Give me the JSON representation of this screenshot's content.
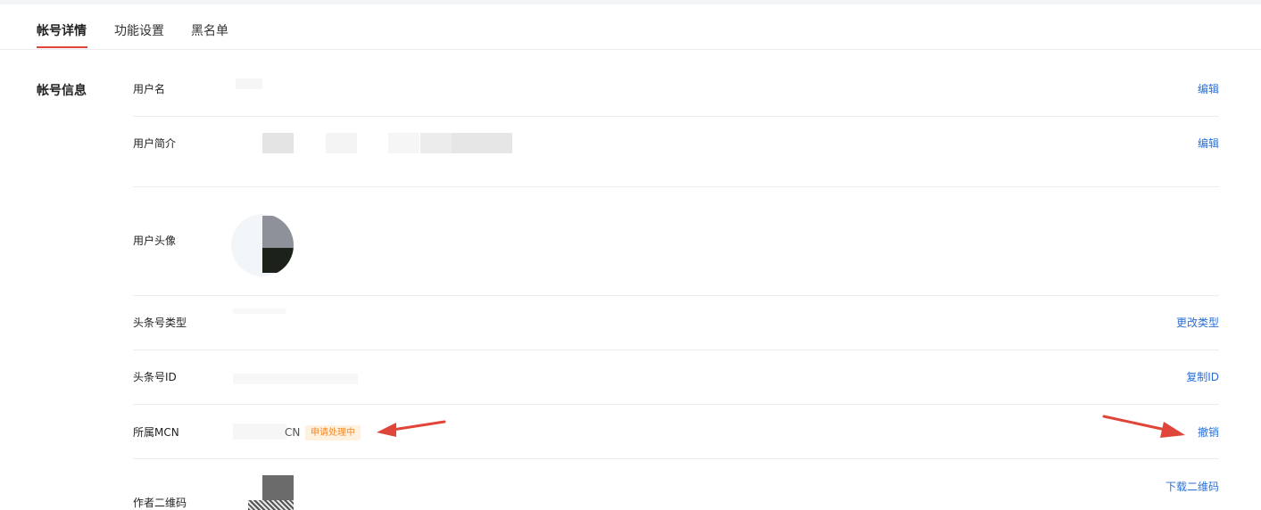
{
  "tabs": [
    {
      "label": "帐号详情",
      "active": true
    },
    {
      "label": "功能设置",
      "active": false
    },
    {
      "label": "黑名单",
      "active": false
    }
  ],
  "section": {
    "title": "帐号信息"
  },
  "rows": {
    "username": {
      "label": "用户名",
      "action": "编辑"
    },
    "bio": {
      "label": "用户简介",
      "action": "编辑"
    },
    "avatar": {
      "label": "用户头像"
    },
    "account_type": {
      "label": "头条号类型",
      "action": "更改类型"
    },
    "account_id": {
      "label": "头条号ID",
      "action": "复制ID"
    },
    "mcn": {
      "label": "所属MCN",
      "value_suffix": "CN",
      "status_badge": "申请处理中",
      "action": "撤销"
    },
    "qrcode": {
      "label": "作者二维码",
      "action": "下载二维码"
    }
  },
  "colors": {
    "accent": "#e0453a",
    "link": "#2a6fd6",
    "badge_text": "#f08a2a",
    "badge_bg": "#fff1e0",
    "annotation_arrow": "#e0453a"
  }
}
